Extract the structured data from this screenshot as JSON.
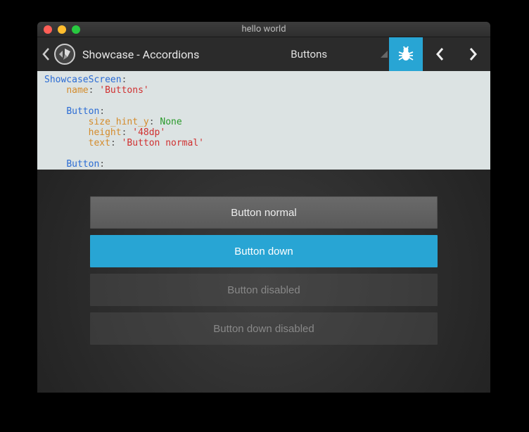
{
  "window": {
    "title": "hello world"
  },
  "header": {
    "title": "Showcase - Accordions",
    "currentScreen": "Buttons"
  },
  "code": {
    "lines": [
      {
        "indent": 0,
        "parts": [
          {
            "t": "ShowcaseScreen",
            "c": "class"
          },
          {
            "t": ":",
            "c": "colon"
          }
        ]
      },
      {
        "indent": 1,
        "parts": [
          {
            "t": "name",
            "c": "prop"
          },
          {
            "t": ": ",
            "c": "colon"
          },
          {
            "t": "'Buttons'",
            "c": "str"
          }
        ]
      },
      {
        "indent": 0,
        "parts": []
      },
      {
        "indent": 1,
        "parts": [
          {
            "t": "Button",
            "c": "class"
          },
          {
            "t": ":",
            "c": "colon"
          }
        ]
      },
      {
        "indent": 2,
        "parts": [
          {
            "t": "size_hint_y",
            "c": "prop"
          },
          {
            "t": ": ",
            "c": "colon"
          },
          {
            "t": "None",
            "c": "none"
          }
        ]
      },
      {
        "indent": 2,
        "parts": [
          {
            "t": "height",
            "c": "prop"
          },
          {
            "t": ": ",
            "c": "colon"
          },
          {
            "t": "'48dp'",
            "c": "str"
          }
        ]
      },
      {
        "indent": 2,
        "parts": [
          {
            "t": "text",
            "c": "prop"
          },
          {
            "t": ": ",
            "c": "colon"
          },
          {
            "t": "'Button normal'",
            "c": "str"
          }
        ]
      },
      {
        "indent": 0,
        "parts": []
      },
      {
        "indent": 1,
        "parts": [
          {
            "t": "Button",
            "c": "class"
          },
          {
            "t": ":",
            "c": "colon"
          }
        ]
      }
    ]
  },
  "buttons": {
    "normal": "Button normal",
    "down": "Button down",
    "disabled": "Button disabled",
    "downDisabled": "Button down disabled"
  },
  "colors": {
    "accent": "#28a5d4"
  }
}
